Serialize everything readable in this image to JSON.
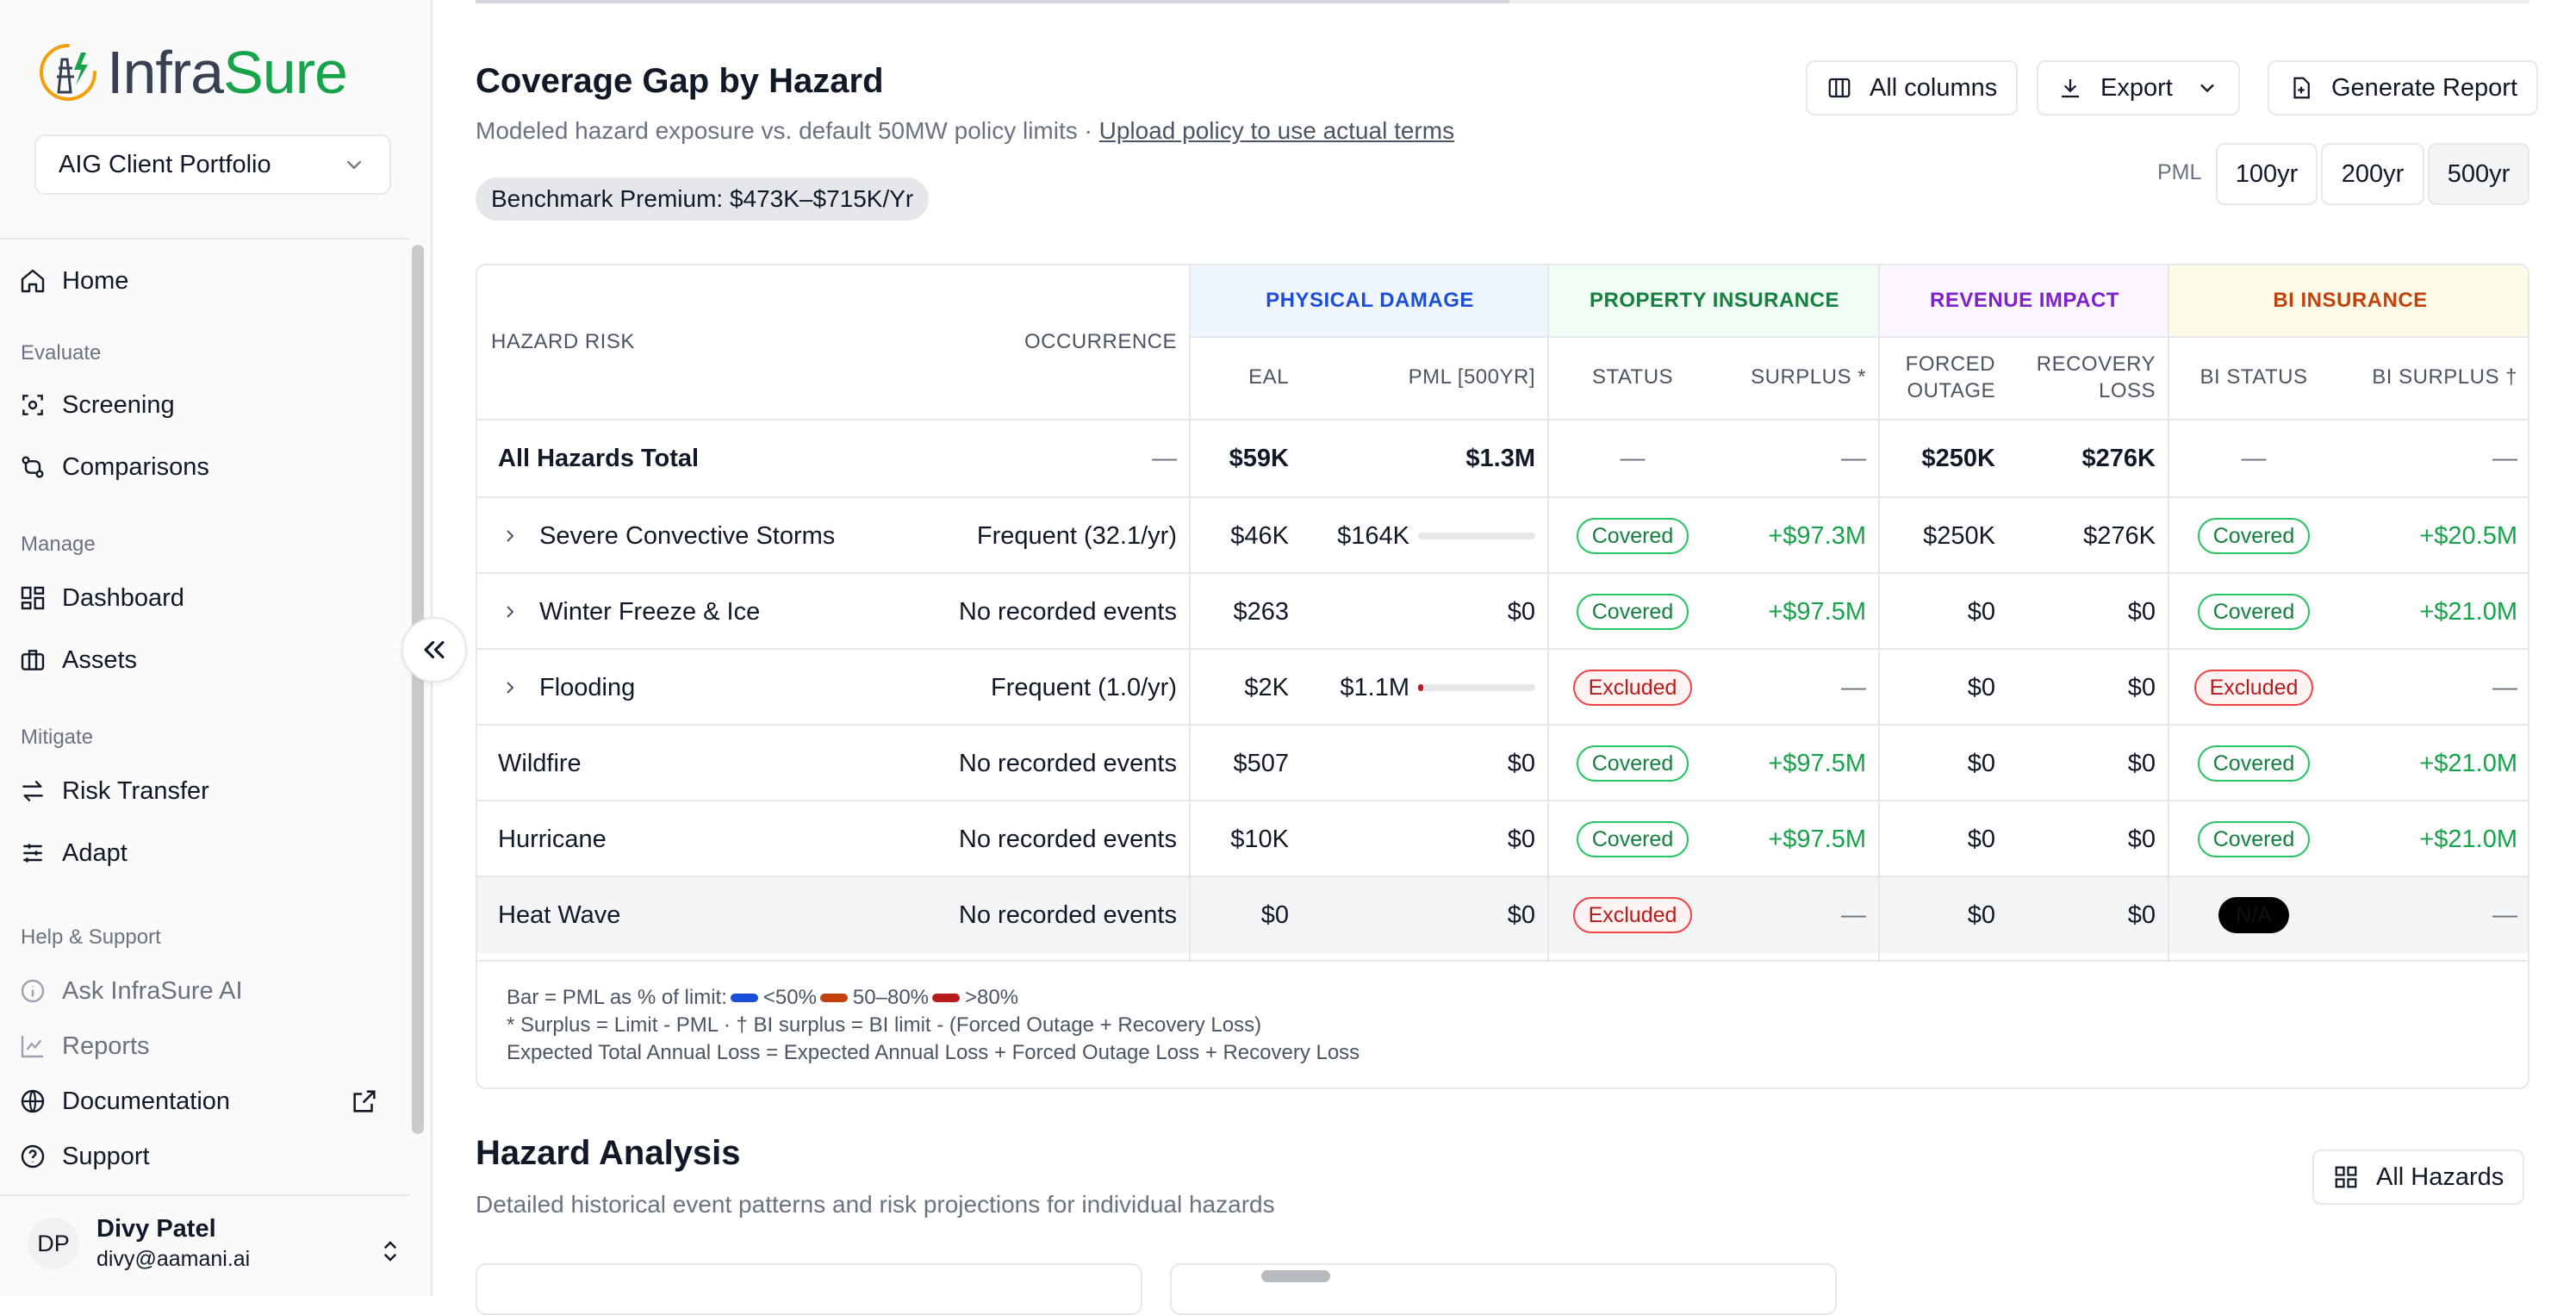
{
  "brand": {
    "name_part1": "Infra",
    "name_part2": "Sure",
    "accent": "#16a34a"
  },
  "portfolio": {
    "selected": "AIG Client Portfolio"
  },
  "nav": {
    "home": "Home",
    "sections": {
      "evaluate": "Evaluate",
      "manage": "Manage",
      "mitigate": "Mitigate",
      "help": "Help & Support"
    },
    "evaluate_items": [
      "Screening",
      "Comparisons"
    ],
    "manage_items": [
      "Dashboard",
      "Assets"
    ],
    "mitigate_items": [
      "Risk Transfer",
      "Adapt"
    ],
    "help_items": [
      "Ask InfraSure AI",
      "Reports",
      "Documentation",
      "Support"
    ]
  },
  "user": {
    "initials": "DP",
    "name": "Divy Patel",
    "email": "divy@aamani.ai"
  },
  "coverage": {
    "title": "Coverage Gap by Hazard",
    "subtitle": "Modeled hazard exposure vs. default 50MW policy limits · ",
    "subtitle_link": "Upload policy to use actual terms",
    "benchmark": "Benchmark Premium: $473K–$715K/Yr",
    "buttons": {
      "columns": "All columns",
      "export": "Export",
      "report": "Generate Report"
    },
    "pml_label": "PML",
    "pml_options": [
      "100yr",
      "200yr",
      "500yr"
    ],
    "pml_selected": "500yr",
    "groups": {
      "physical": "PHYSICAL DAMAGE",
      "property": "PROPERTY INSURANCE",
      "revenue": "REVENUE IMPACT",
      "bi": "BI INSURANCE"
    },
    "group_colors": {
      "physical": {
        "bg": "#eff6ff",
        "fg": "#1d4ed8"
      },
      "property": {
        "bg": "#f0fdf4",
        "fg": "#15803d"
      },
      "revenue": {
        "bg": "#faf5ff",
        "fg": "#7e22ce"
      },
      "bi": {
        "bg": "#fefce8",
        "fg": "#c2410c"
      }
    },
    "headers": {
      "hazard": "HAZARD RISK",
      "occurrence": "OCCURRENCE",
      "eal": "EAL",
      "pml": "PML [500YR]",
      "status": "STATUS",
      "surplus": "SURPLUS *",
      "forced_1": "FORCED",
      "forced_2": "OUTAGE",
      "recovery_1": "RECOVERY",
      "recovery_2": "LOSS",
      "bi_status": "BI STATUS",
      "bi_surplus": "BI SURPLUS †"
    },
    "total": {
      "label": "All Hazards Total",
      "occurrence": "—",
      "eal": "$59K",
      "pml": "$1.3M",
      "status": "—",
      "surplus": "—",
      "forced": "$250K",
      "recovery": "$276K",
      "bi_status": "—",
      "bi_surplus": "—"
    },
    "rows": [
      {
        "hazard": "Severe Convective Storms",
        "expandable": true,
        "occurrence": "Frequent (32.1/yr)",
        "eal": "$46K",
        "pml": "$164K",
        "pml_pct": 0.0,
        "bar_color": "#1d4ed8",
        "status": "Covered",
        "surplus": "+$97.3M",
        "forced": "$250K",
        "recovery": "$276K",
        "bi_status": "Covered",
        "bi_surplus": "+$20.5M"
      },
      {
        "hazard": "Winter Freeze & Ice",
        "expandable": true,
        "occurrence": "No recorded events",
        "eal": "$263",
        "pml": "$0",
        "status": "Covered",
        "surplus": "+$97.5M",
        "forced": "$0",
        "recovery": "$0",
        "bi_status": "Covered",
        "bi_surplus": "+$21.0M"
      },
      {
        "hazard": "Flooding",
        "expandable": true,
        "occurrence": "Frequent (1.0/yr)",
        "eal": "$2K",
        "pml": "$1.1M",
        "pml_pct": 0.04,
        "bar_color": "#b91c1c",
        "status": "Excluded",
        "surplus": "—",
        "forced": "$0",
        "recovery": "$0",
        "bi_status": "Excluded",
        "bi_surplus": "—"
      },
      {
        "hazard": "Wildfire",
        "expandable": false,
        "occurrence": "No recorded events",
        "eal": "$507",
        "pml": "$0",
        "status": "Covered",
        "surplus": "+$97.5M",
        "forced": "$0",
        "recovery": "$0",
        "bi_status": "Covered",
        "bi_surplus": "+$21.0M"
      },
      {
        "hazard": "Hurricane",
        "expandable": false,
        "occurrence": "No recorded events",
        "eal": "$10K",
        "pml": "$0",
        "status": "Covered",
        "surplus": "+$97.5M",
        "forced": "$0",
        "recovery": "$0",
        "bi_status": "Covered",
        "bi_surplus": "+$21.0M"
      },
      {
        "hazard": "Heat Wave",
        "expandable": false,
        "occurrence": "No recorded events",
        "eal": "$0",
        "pml": "$0",
        "status": "Excluded",
        "surplus": "—",
        "forced": "$0",
        "recovery": "$0",
        "bi_status": "N/A",
        "bi_surplus": "—"
      }
    ],
    "legend": {
      "prefix": "Bar = PML as % of limit:",
      "items": [
        {
          "label": "<50%",
          "color": "#1d4ed8"
        },
        {
          "label": "50–80%",
          "color": "#c2410c"
        },
        {
          "label": ">80%",
          "color": "#b91c1c"
        }
      ],
      "note1": "* Surplus = Limit - PML · † BI surplus = BI limit - (Forced Outage + Recovery Loss)",
      "note2": "Expected Total Annual Loss = Expected Annual Loss + Forced Outage Loss + Recovery Loss"
    }
  },
  "hazard_analysis": {
    "title": "Hazard Analysis",
    "subtitle": "Detailed historical event patterns and risk projections for individual hazards",
    "button": "All Hazards"
  }
}
